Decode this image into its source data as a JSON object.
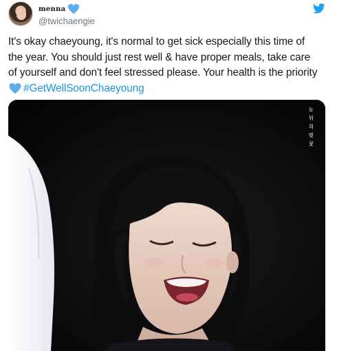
{
  "user": {
    "display_name": "menna",
    "handle": "@twichaengie",
    "name_emoji": "blue-heart-icon"
  },
  "tweet": {
    "lines": [
      "It's okay chaeyoung, it's normal to get sick especially this time of",
      "the year. You should just rest well & have proper meals, take care",
      "of yourself and don't feel stressed please. Your health is the priority"
    ],
    "hashtag": "#GetWellSoonChaeyoung",
    "hashtag_emoji": "blue-heart-icon"
  },
  "media": {
    "watermark": "눈뒤의벚꽃"
  },
  "colors": {
    "heart": "#5dadec",
    "twitter_blue": "#1da1f2",
    "hashtag": "#1b95e0",
    "handle": "#657786"
  }
}
